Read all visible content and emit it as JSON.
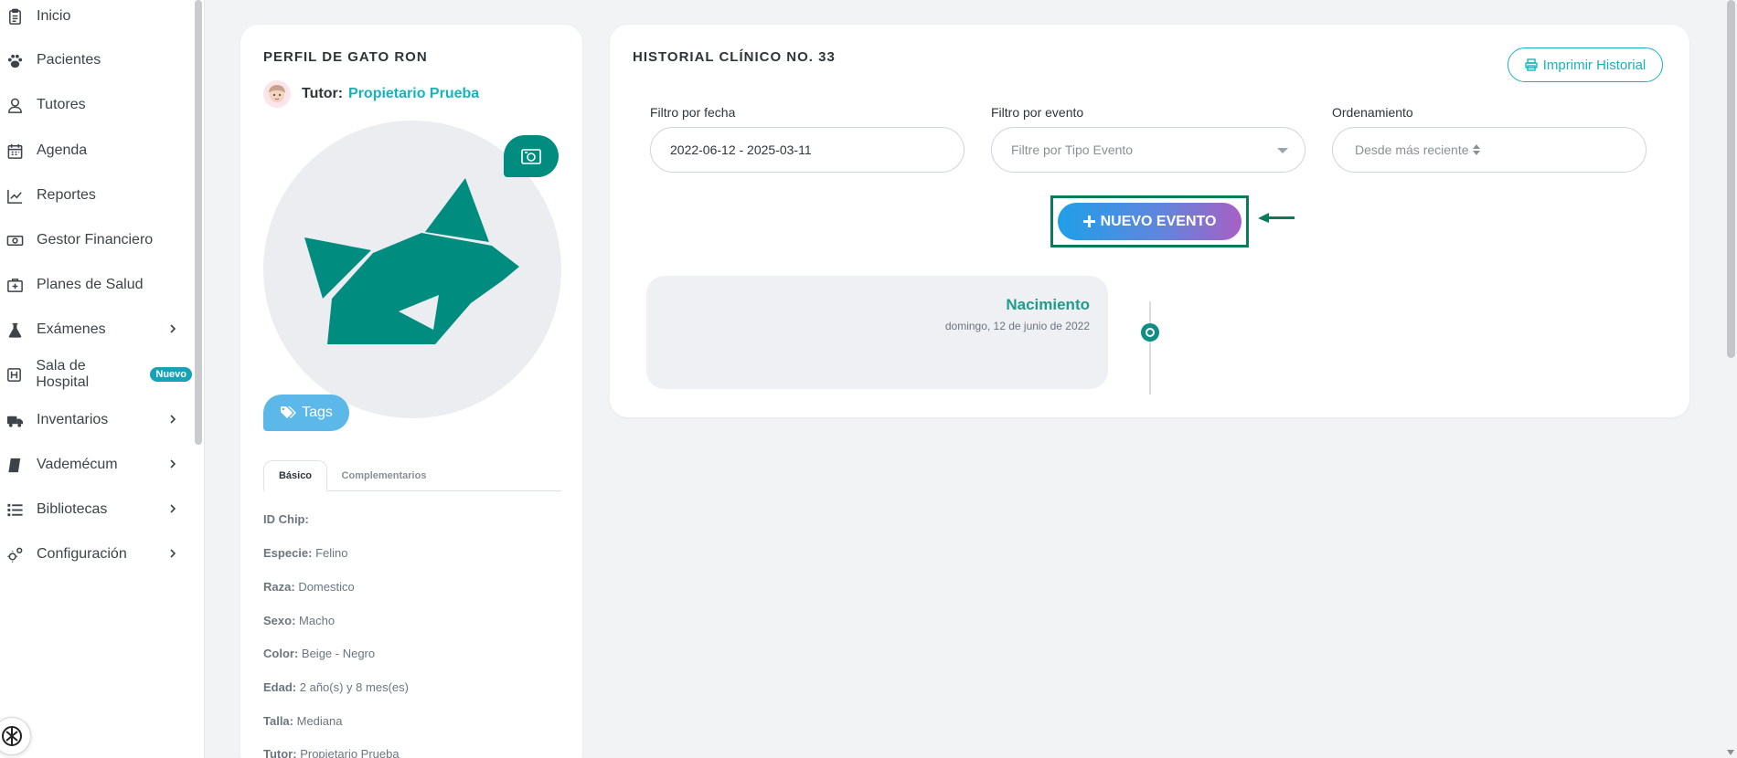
{
  "sidebar": {
    "items": [
      {
        "label": "Inicio",
        "icon": "clipboard-icon"
      },
      {
        "label": "Pacientes",
        "icon": "paw-icon"
      },
      {
        "label": "Tutores",
        "icon": "user-icon"
      },
      {
        "label": "Agenda",
        "icon": "calendar-icon"
      },
      {
        "label": "Reportes",
        "icon": "line-chart-icon"
      },
      {
        "label": "Gestor Financiero",
        "icon": "money-icon"
      },
      {
        "label": "Planes de Salud",
        "icon": "medkit-icon"
      },
      {
        "label": "Exámenes",
        "icon": "flask-icon"
      },
      {
        "label": "Sala de Hospital",
        "icon": "hospital-icon",
        "badge": "Nuevo"
      },
      {
        "label": "Inventarios",
        "icon": "truck-icon"
      },
      {
        "label": "Vademécum",
        "icon": "book-icon"
      },
      {
        "label": "Bibliotecas",
        "icon": "list-icon"
      },
      {
        "label": "Configuración",
        "icon": "cogs-icon"
      }
    ]
  },
  "profile": {
    "title": "PERFIL DE GATO RON",
    "tutor_label": "Tutor:",
    "tutor_name": "Propietario Prueba",
    "tags_label": "Tags",
    "tabs": {
      "basic": "Básico",
      "extra": "Complementarios"
    },
    "fields": [
      {
        "label": "ID Chip:",
        "value": ""
      },
      {
        "label": "Especie:",
        "value": "Felino"
      },
      {
        "label": "Raza:",
        "value": "Domestico"
      },
      {
        "label": "Sexo:",
        "value": "Macho"
      },
      {
        "label": "Color:",
        "value": "Beige - Negro"
      },
      {
        "label": "Edad:",
        "value": "2 año(s) y 8 mes(es)"
      },
      {
        "label": "Talla:",
        "value": "Mediana"
      },
      {
        "label": "Tutor:",
        "value": "Propietario Prueba"
      }
    ]
  },
  "history": {
    "title": "HISTORIAL CLÍNICO NO. 33",
    "print_label": "Imprimir Historial",
    "filters": {
      "date_label": "Filtro por fecha",
      "date_value": "2022-06-12 - 2025-03-11",
      "event_label": "Filtro por evento",
      "event_placeholder": "Filtre por Tipo Evento",
      "order_label": "Ordenamiento",
      "order_value": "Desde más reciente"
    },
    "new_event_label": "NUEVO EVENTO",
    "timeline": [
      {
        "title": "Nacimiento",
        "date": "domingo, 12 de junio de 2022"
      }
    ]
  },
  "colors": {
    "accent": "#17b3bd",
    "primary_green": "#008c7e",
    "badge": "#17a2b8",
    "highlight": "#0b7b5a"
  }
}
